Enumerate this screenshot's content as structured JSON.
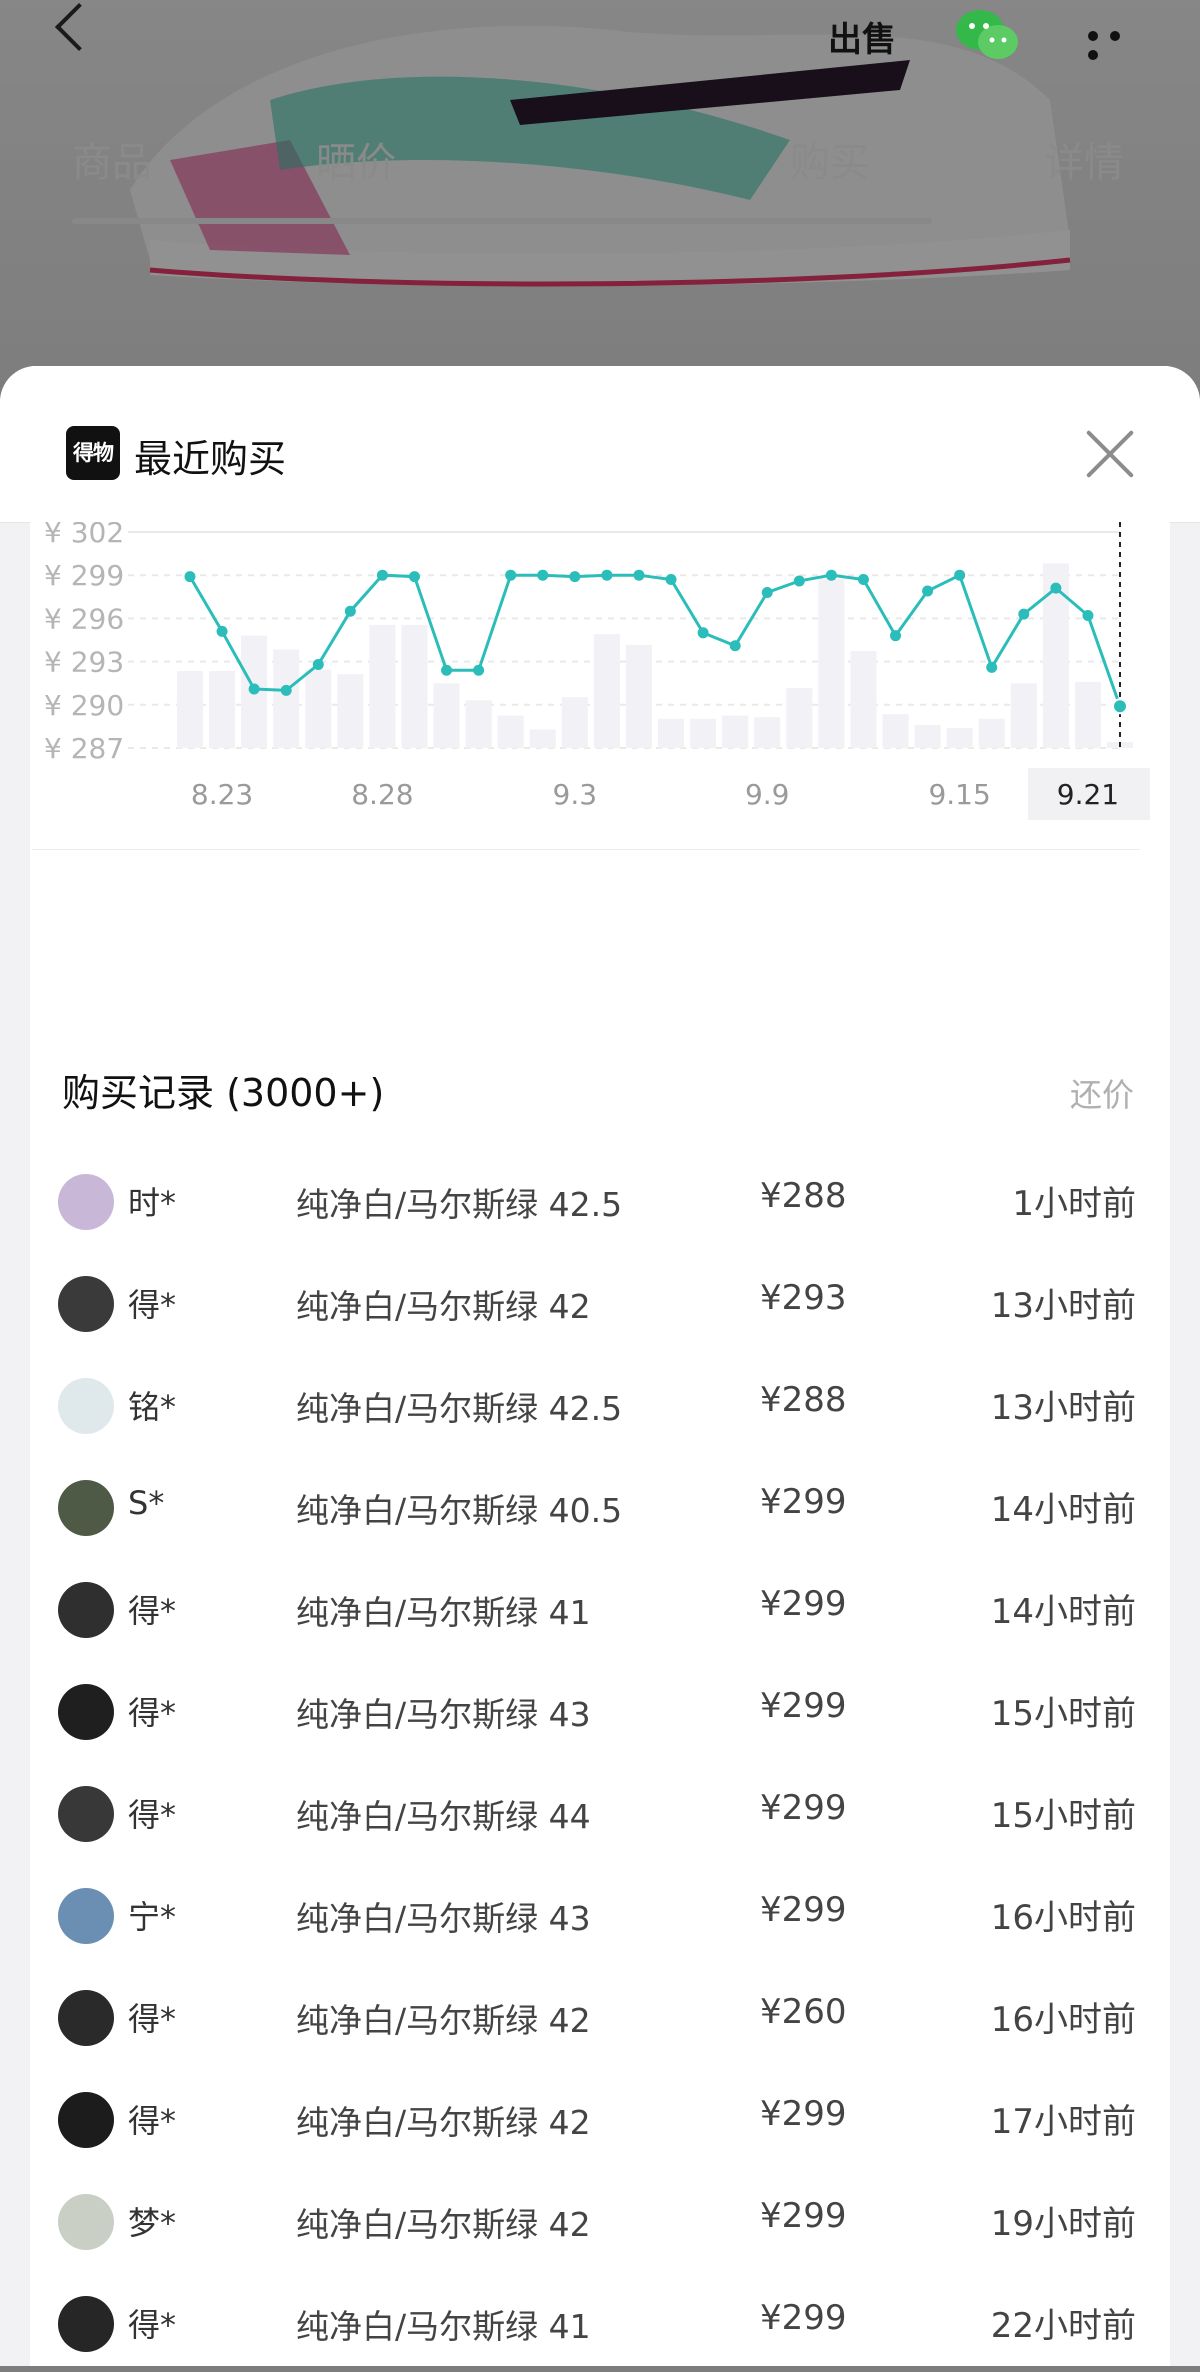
{
  "nav": {
    "sell_label": "出售",
    "back_icon": "chevron-left-icon",
    "wechat_icon": "wechat-icon",
    "more_icon": "more-dots-icon"
  },
  "background_tabs": [
    "商品",
    "晒价",
    "",
    "购买",
    "详情"
  ],
  "sheet": {
    "logo_text": "得物",
    "title": "最近购买",
    "close_icon": "close-icon"
  },
  "chart_data": {
    "type": "line",
    "y_tick_labels": [
      "¥ 302",
      "¥ 299",
      "¥ 296",
      "¥ 293",
      "¥ 290",
      "¥ 287"
    ],
    "y_ticks": [
      302,
      299,
      296,
      293,
      290,
      287
    ],
    "ylim": [
      287,
      302
    ],
    "x_tick_labels": [
      "8.23",
      "8.28",
      "9.3",
      "9.9",
      "9.15",
      "9.21"
    ],
    "x_tick_index": [
      1,
      6,
      12,
      18,
      24,
      28
    ],
    "highlighted_x_label": "9.21",
    "grid": true,
    "line_color": "#2bbdb9",
    "series": [
      {
        "values": [
          298.9,
          295.1,
          291.1,
          291.0,
          292.8,
          296.5,
          299.0,
          298.9,
          292.4,
          292.4,
          299.0,
          299.0,
          298.9,
          299.0,
          299.0,
          298.7,
          295.0,
          294.1,
          297.8,
          298.6,
          299.0,
          298.7,
          294.8,
          297.9,
          299.0,
          292.6,
          296.3,
          298.1,
          296.2,
          289.9
        ]
      }
    ],
    "volume_bars": [
      5,
      5,
      7.3,
      6.4,
      5.1,
      4.8,
      8,
      8,
      4.2,
      3.1,
      2.1,
      1.2,
      3.3,
      7.4,
      6.7,
      1.9,
      1.9,
      2.1,
      2.0,
      3.9,
      11,
      6.3,
      2.2,
      1.5,
      1.3,
      1.9,
      4.2,
      12,
      4.3,
      0.4
    ]
  },
  "records": {
    "title": "购买记录 (3000+)",
    "action": "还价",
    "rows": [
      {
        "user": "时*",
        "spec": "纯净白/马尔斯绿 42.5",
        "price": "¥288",
        "time": "1小时前",
        "avatar_color": "#c9b7d8"
      },
      {
        "user": "得*",
        "spec": "纯净白/马尔斯绿 42",
        "price": "¥293",
        "time": "13小时前",
        "avatar_color": "#3a3a3a"
      },
      {
        "user": "铭*",
        "spec": "纯净白/马尔斯绿 42.5",
        "price": "¥288",
        "time": "13小时前",
        "avatar_color": "#dfe8ea"
      },
      {
        "user": "S*",
        "spec": "纯净白/马尔斯绿 40.5",
        "price": "¥299",
        "time": "14小时前",
        "avatar_color": "#4e5a45"
      },
      {
        "user": "得*",
        "spec": "纯净白/马尔斯绿 41",
        "price": "¥299",
        "time": "14小时前",
        "avatar_color": "#2f2f2f"
      },
      {
        "user": "得*",
        "spec": "纯净白/马尔斯绿 43",
        "price": "¥299",
        "time": "15小时前",
        "avatar_color": "#1f1f1f"
      },
      {
        "user": "得*",
        "spec": "纯净白/马尔斯绿 44",
        "price": "¥299",
        "time": "15小时前",
        "avatar_color": "#383838"
      },
      {
        "user": "宁*",
        "spec": "纯净白/马尔斯绿 43",
        "price": "¥299",
        "time": "16小时前",
        "avatar_color": "#6b8fb3"
      },
      {
        "user": "得*",
        "spec": "纯净白/马尔斯绿 42",
        "price": "¥260",
        "time": "16小时前",
        "avatar_color": "#2a2a2a"
      },
      {
        "user": "得*",
        "spec": "纯净白/马尔斯绿 42",
        "price": "¥299",
        "time": "17小时前",
        "avatar_color": "#1c1c1c"
      },
      {
        "user": "梦*",
        "spec": "纯净白/马尔斯绿 42",
        "price": "¥299",
        "time": "19小时前",
        "avatar_color": "#c9cfc4"
      },
      {
        "user": "得*",
        "spec": "纯净白/马尔斯绿 41",
        "price": "¥299",
        "time": "22小时前",
        "avatar_color": "#262626"
      }
    ]
  }
}
